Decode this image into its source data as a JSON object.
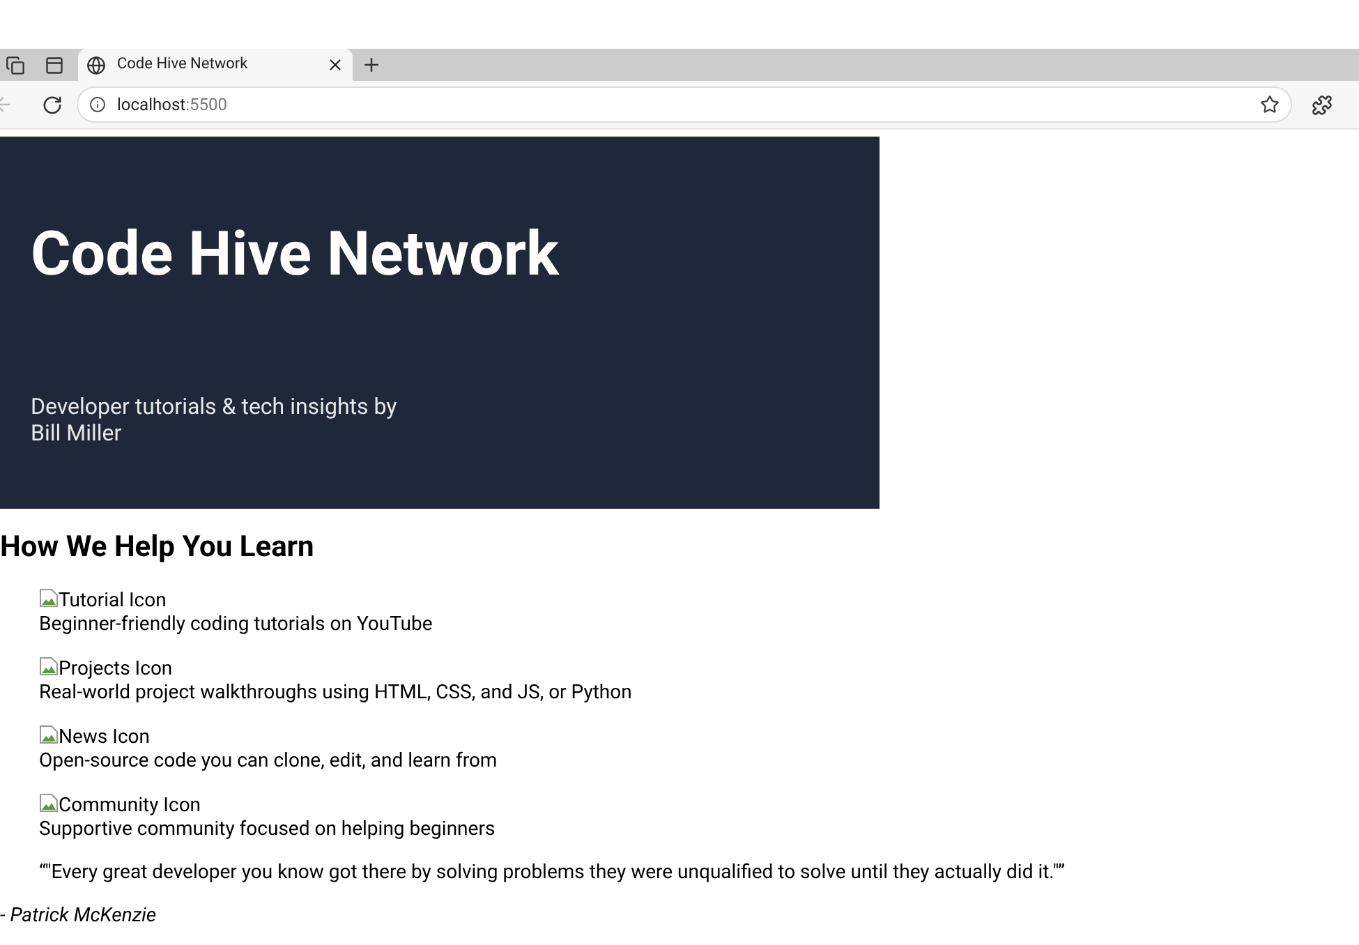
{
  "browser": {
    "tab_title": "Code Hive Network",
    "url_host": "localhost",
    "url_port": ":5500"
  },
  "hero": {
    "title": "Code Hive Network",
    "subtitle": "Developer tutorials & tech insights by Bill Miller"
  },
  "section": {
    "heading": "How We Help You Learn",
    "items": [
      {
        "image_alt": "Tutorial Icon",
        "text": "Beginner-friendly coding tutorials on YouTube"
      },
      {
        "image_alt": "Projects Icon",
        "text": "Real-world project walkthroughs using HTML, CSS, and JS, or Python"
      },
      {
        "image_alt": "News Icon",
        "text": "Open-source code you can clone, edit, and learn from"
      },
      {
        "image_alt": "Community Icon",
        "text": "Supportive community focused on helping beginners"
      }
    ]
  },
  "quote": {
    "text": "“\"Every great developer you know got there by solving problems they were unqualified to solve until they actually did it.\"”",
    "author": "- Patrick McKenzie"
  }
}
